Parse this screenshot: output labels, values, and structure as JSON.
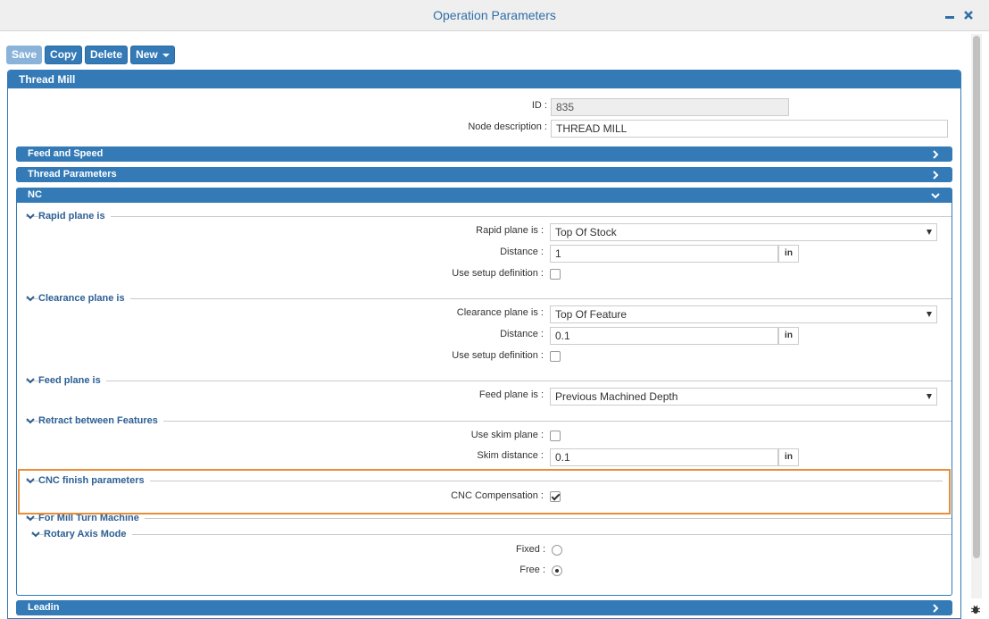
{
  "window": {
    "title": "Operation Parameters",
    "minimize_label": "–",
    "close_label": "✕"
  },
  "toolbar": {
    "save": "Save",
    "copy": "Copy",
    "delete": "Delete",
    "new": "New"
  },
  "panel": {
    "title": "Thread Mill"
  },
  "node": {
    "id_label": "ID :",
    "id_value": "835",
    "desc_label": "Node description :",
    "desc_value": "THREAD MILL"
  },
  "bars": {
    "feed_speed": "Feed and Speed",
    "thread_params": "Thread Parameters",
    "nc": "NC",
    "leadin": "Leadin"
  },
  "rapid": {
    "section": "Rapid plane is",
    "plane_label": "Rapid plane is :",
    "plane_value": "Top Of Stock",
    "distance_label": "Distance :",
    "distance_value": "1",
    "unit": "in",
    "setup_label": "Use setup definition :"
  },
  "clearance": {
    "section": "Clearance plane is",
    "plane_label": "Clearance plane is :",
    "plane_value": "Top Of Feature",
    "distance_label": "Distance :",
    "distance_value": "0.1",
    "unit": "in",
    "setup_label": "Use setup definition :"
  },
  "feed": {
    "section": "Feed plane is",
    "plane_label": "Feed plane is :",
    "plane_value": "Previous Machined Depth"
  },
  "retract": {
    "section": "Retract between Features",
    "skim_label": "Use skim plane :",
    "skim_distance_label": "Skim distance :",
    "skim_distance_value": "0.1",
    "unit": "in"
  },
  "cnc": {
    "section": "CNC finish parameters",
    "comp_label": "CNC Compensation :",
    "comp_checked": true
  },
  "millturn": {
    "section": "For Mill Turn Machine",
    "rotary_section": "Rotary Axis Mode",
    "fixed_label": "Fixed :",
    "free_label": "Free :",
    "selected": "Free"
  },
  "colors": {
    "accent": "#337ab7",
    "highlight": "#ea8d37",
    "section_text": "#2c5f94"
  }
}
